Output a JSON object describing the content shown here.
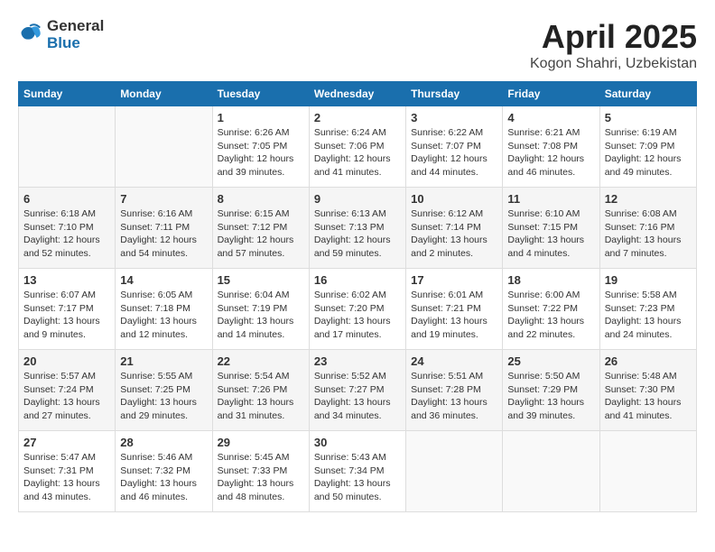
{
  "header": {
    "logo_general": "General",
    "logo_blue": "Blue",
    "month_title": "April 2025",
    "subtitle": "Kogon Shahri, Uzbekistan"
  },
  "days_of_week": [
    "Sunday",
    "Monday",
    "Tuesday",
    "Wednesday",
    "Thursday",
    "Friday",
    "Saturday"
  ],
  "weeks": [
    [
      {
        "day": "",
        "empty": true
      },
      {
        "day": "",
        "empty": true
      },
      {
        "day": "1",
        "sunrise": "6:26 AM",
        "sunset": "7:05 PM",
        "daylight": "12 hours and 39 minutes."
      },
      {
        "day": "2",
        "sunrise": "6:24 AM",
        "sunset": "7:06 PM",
        "daylight": "12 hours and 41 minutes."
      },
      {
        "day": "3",
        "sunrise": "6:22 AM",
        "sunset": "7:07 PM",
        "daylight": "12 hours and 44 minutes."
      },
      {
        "day": "4",
        "sunrise": "6:21 AM",
        "sunset": "7:08 PM",
        "daylight": "12 hours and 46 minutes."
      },
      {
        "day": "5",
        "sunrise": "6:19 AM",
        "sunset": "7:09 PM",
        "daylight": "12 hours and 49 minutes."
      }
    ],
    [
      {
        "day": "6",
        "sunrise": "6:18 AM",
        "sunset": "7:10 PM",
        "daylight": "12 hours and 52 minutes."
      },
      {
        "day": "7",
        "sunrise": "6:16 AM",
        "sunset": "7:11 PM",
        "daylight": "12 hours and 54 minutes."
      },
      {
        "day": "8",
        "sunrise": "6:15 AM",
        "sunset": "7:12 PM",
        "daylight": "12 hours and 57 minutes."
      },
      {
        "day": "9",
        "sunrise": "6:13 AM",
        "sunset": "7:13 PM",
        "daylight": "12 hours and 59 minutes."
      },
      {
        "day": "10",
        "sunrise": "6:12 AM",
        "sunset": "7:14 PM",
        "daylight": "13 hours and 2 minutes."
      },
      {
        "day": "11",
        "sunrise": "6:10 AM",
        "sunset": "7:15 PM",
        "daylight": "13 hours and 4 minutes."
      },
      {
        "day": "12",
        "sunrise": "6:08 AM",
        "sunset": "7:16 PM",
        "daylight": "13 hours and 7 minutes."
      }
    ],
    [
      {
        "day": "13",
        "sunrise": "6:07 AM",
        "sunset": "7:17 PM",
        "daylight": "13 hours and 9 minutes."
      },
      {
        "day": "14",
        "sunrise": "6:05 AM",
        "sunset": "7:18 PM",
        "daylight": "13 hours and 12 minutes."
      },
      {
        "day": "15",
        "sunrise": "6:04 AM",
        "sunset": "7:19 PM",
        "daylight": "13 hours and 14 minutes."
      },
      {
        "day": "16",
        "sunrise": "6:02 AM",
        "sunset": "7:20 PM",
        "daylight": "13 hours and 17 minutes."
      },
      {
        "day": "17",
        "sunrise": "6:01 AM",
        "sunset": "7:21 PM",
        "daylight": "13 hours and 19 minutes."
      },
      {
        "day": "18",
        "sunrise": "6:00 AM",
        "sunset": "7:22 PM",
        "daylight": "13 hours and 22 minutes."
      },
      {
        "day": "19",
        "sunrise": "5:58 AM",
        "sunset": "7:23 PM",
        "daylight": "13 hours and 24 minutes."
      }
    ],
    [
      {
        "day": "20",
        "sunrise": "5:57 AM",
        "sunset": "7:24 PM",
        "daylight": "13 hours and 27 minutes."
      },
      {
        "day": "21",
        "sunrise": "5:55 AM",
        "sunset": "7:25 PM",
        "daylight": "13 hours and 29 minutes."
      },
      {
        "day": "22",
        "sunrise": "5:54 AM",
        "sunset": "7:26 PM",
        "daylight": "13 hours and 31 minutes."
      },
      {
        "day": "23",
        "sunrise": "5:52 AM",
        "sunset": "7:27 PM",
        "daylight": "13 hours and 34 minutes."
      },
      {
        "day": "24",
        "sunrise": "5:51 AM",
        "sunset": "7:28 PM",
        "daylight": "13 hours and 36 minutes."
      },
      {
        "day": "25",
        "sunrise": "5:50 AM",
        "sunset": "7:29 PM",
        "daylight": "13 hours and 39 minutes."
      },
      {
        "day": "26",
        "sunrise": "5:48 AM",
        "sunset": "7:30 PM",
        "daylight": "13 hours and 41 minutes."
      }
    ],
    [
      {
        "day": "27",
        "sunrise": "5:47 AM",
        "sunset": "7:31 PM",
        "daylight": "13 hours and 43 minutes."
      },
      {
        "day": "28",
        "sunrise": "5:46 AM",
        "sunset": "7:32 PM",
        "daylight": "13 hours and 46 minutes."
      },
      {
        "day": "29",
        "sunrise": "5:45 AM",
        "sunset": "7:33 PM",
        "daylight": "13 hours and 48 minutes."
      },
      {
        "day": "30",
        "sunrise": "5:43 AM",
        "sunset": "7:34 PM",
        "daylight": "13 hours and 50 minutes."
      },
      {
        "day": "",
        "empty": true
      },
      {
        "day": "",
        "empty": true
      },
      {
        "day": "",
        "empty": true
      }
    ]
  ]
}
